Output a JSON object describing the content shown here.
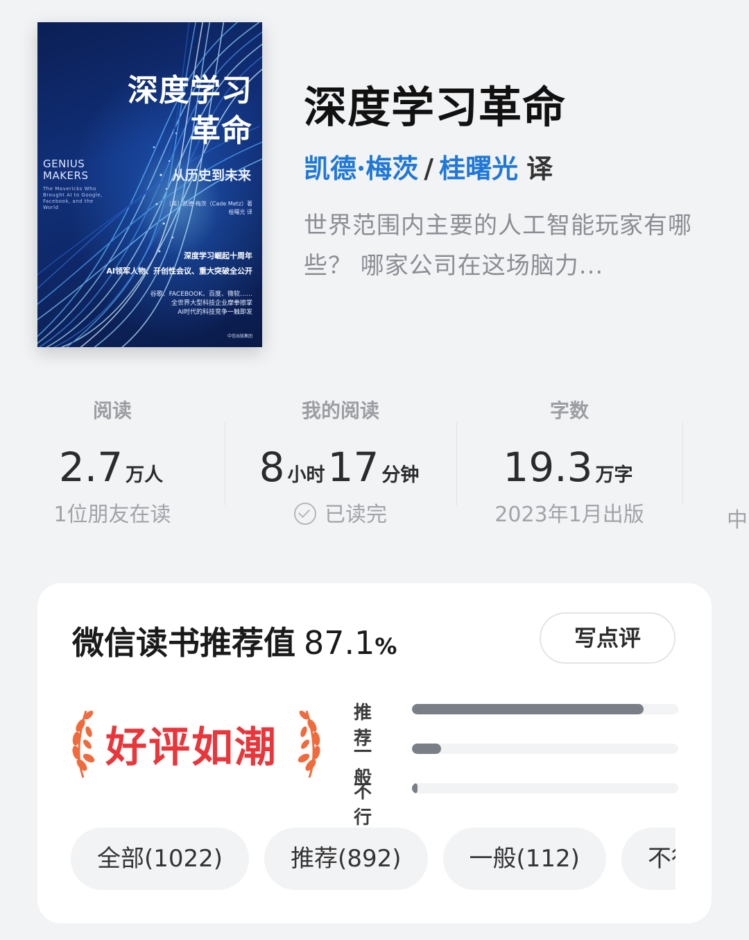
{
  "cover": {
    "title_line1": "深度学习",
    "title_line2": "革命",
    "subtitle": "从历史到未来",
    "en_line1": "GENIUS",
    "en_line2": "MAKERS",
    "en_tagline": "The Mavericks Who Brought AI to Google, Facebook, and the World",
    "author": "〔美〕凯德·梅茨（Cade Metz）著",
    "translator": "桂曙光 译",
    "tag_line1": "深度学习崛起十周年",
    "tag_line2": "AI领军人物、开创性会议、重大突破全公开",
    "promo_line1": "谷歌、FACEBOOK、百度、微软……",
    "promo_line2": "全世界大型科技企业摩拳擦掌",
    "promo_line3": "AI时代的科技竞争一触即发",
    "publisher": "中信出版集团"
  },
  "book": {
    "title": "深度学习革命",
    "author": "凯德·梅茨",
    "separator": "/",
    "translator": "桂曙光",
    "translator_suffix": "译",
    "intro": "世界范围内主要的人工智能玩家有哪些？ 哪家公司在这场脑力..."
  },
  "stats": [
    {
      "label": "阅读",
      "num1": "2.7",
      "unit1": "万人",
      "foot": "1位朋友在读"
    },
    {
      "label": "我的阅读",
      "num1": "8",
      "unit1": "小时",
      "num2": "17",
      "unit2": "分钟",
      "foot": "已读完"
    },
    {
      "label": "字数",
      "num1": "19.3",
      "unit1": "万字",
      "foot": "2023年1月出版"
    },
    {
      "foot": "中"
    }
  ],
  "rating": {
    "title": "微信读书推荐值",
    "value": "87.1",
    "value_unit": "%",
    "write_button": "写点评",
    "badge": "好评如潮",
    "bars": [
      {
        "label": "推荐",
        "fraction": 0.87
      },
      {
        "label": "一般",
        "fraction": 0.11
      },
      {
        "label": "不行",
        "fraction": 0.02
      }
    ],
    "filters": [
      "全部(1022)",
      "推荐(892)",
      "一般(112)",
      "不行"
    ]
  },
  "colors": {
    "accent_blue": "#1f78d8",
    "badge_red": "#e9363a",
    "badge_laurel": "#f06a3c",
    "bar_fill": "#7a7f87"
  }
}
